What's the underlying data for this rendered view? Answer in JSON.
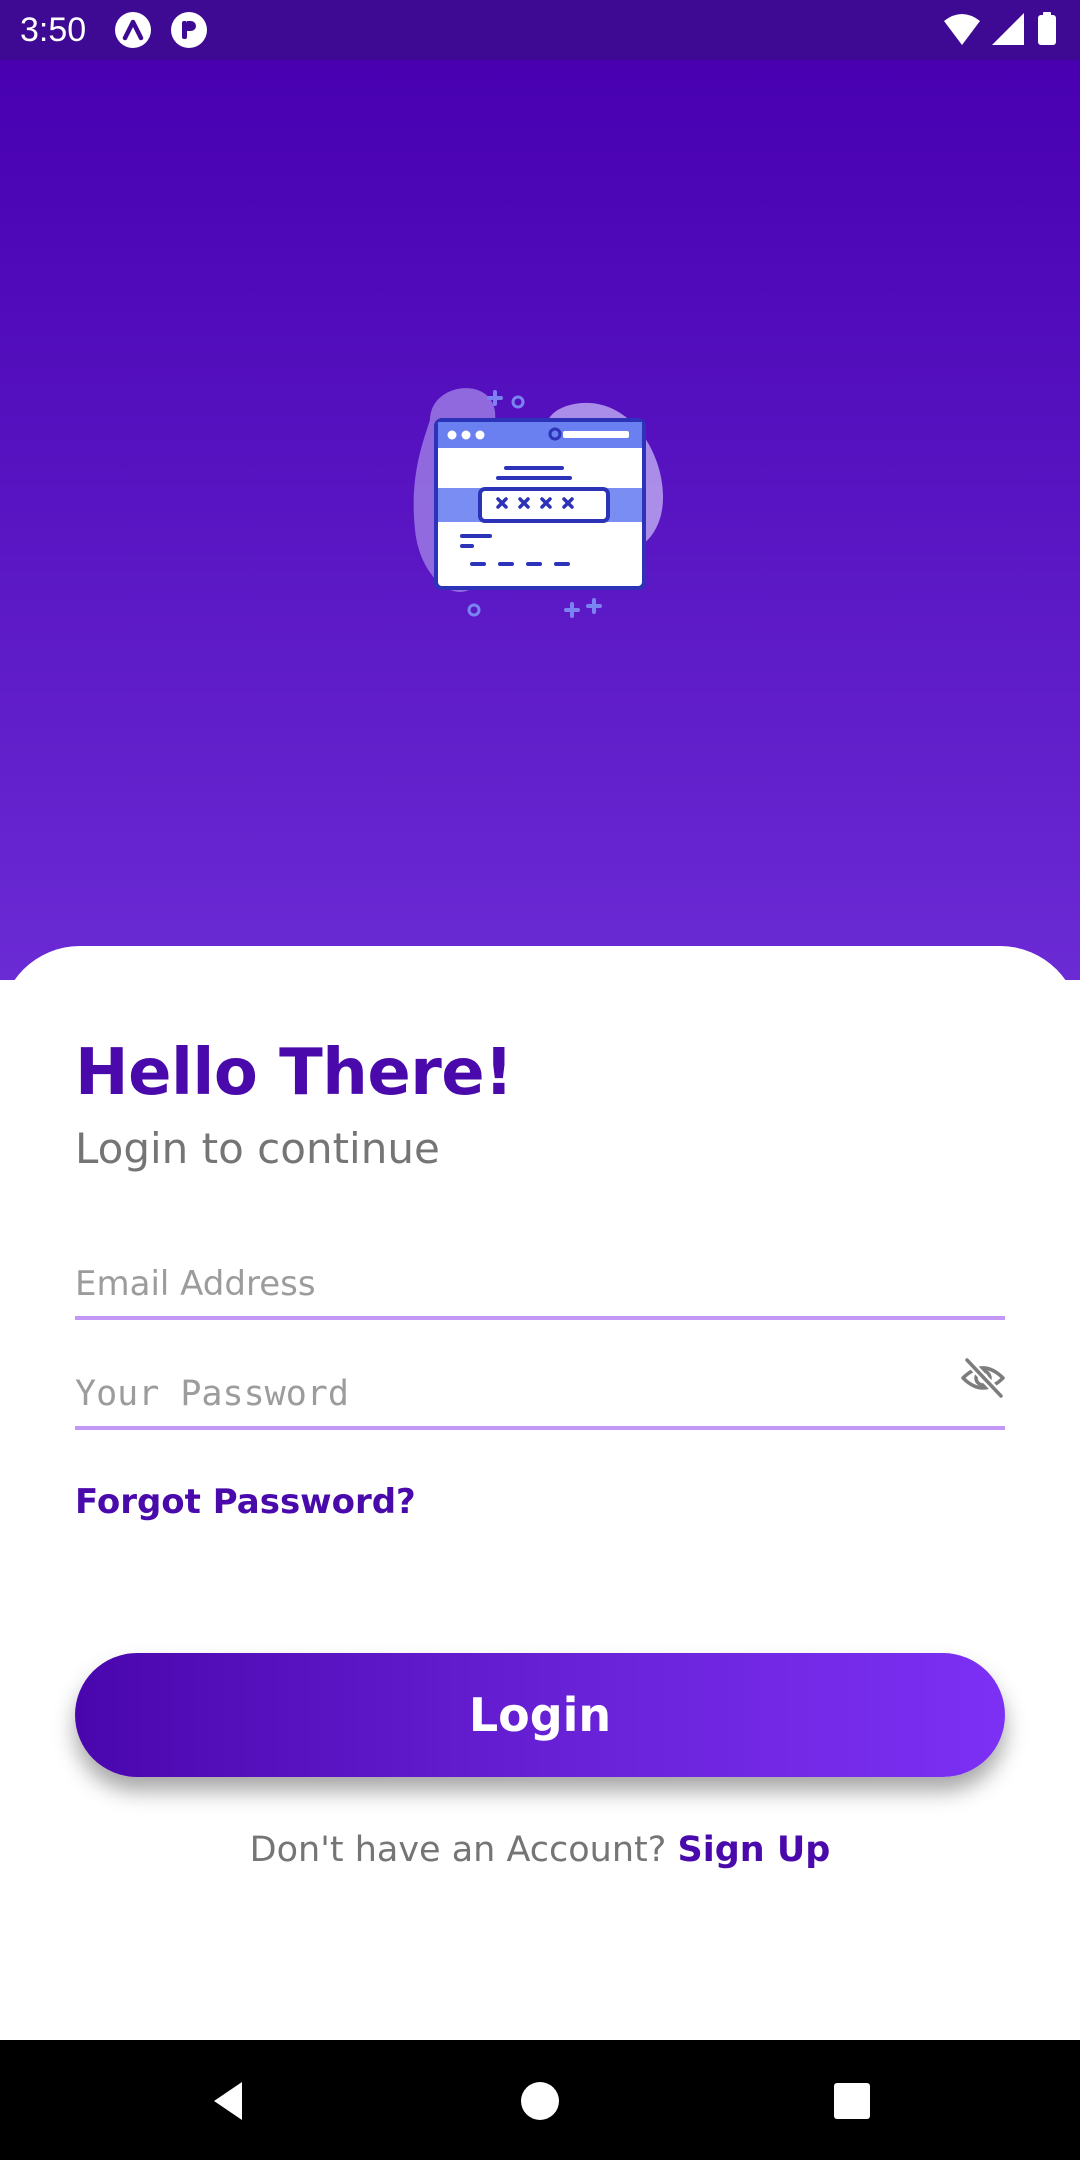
{
  "status_bar": {
    "time": "3:50",
    "icons": [
      "app-icon-a",
      "app-icon-b",
      "wifi-icon",
      "signal-icon",
      "battery-icon"
    ]
  },
  "hero": {
    "illustration": "browser-login-illustration",
    "colors": {
      "gradient_top": "#4800b1",
      "gradient_bottom": "#6a2ad4"
    }
  },
  "login": {
    "title": "Hello There!",
    "subtitle": "Login to continue",
    "email": {
      "placeholder": "Email Address",
      "value": ""
    },
    "password": {
      "placeholder": "Your Password",
      "value": "",
      "toggle_icon": "eye-off-icon"
    },
    "forgot_password": "Forgot Password?",
    "login_button": "Login",
    "signup_prompt": "Don't have an Account?",
    "signup_link": "Sign Up"
  },
  "theme": {
    "primary": "#4a0aab",
    "accent": "#7c30f4",
    "underline": "#c397f4",
    "muted_text": "#757575"
  },
  "nav_bar": {
    "buttons": [
      "back-icon",
      "home-icon",
      "recents-icon"
    ]
  }
}
